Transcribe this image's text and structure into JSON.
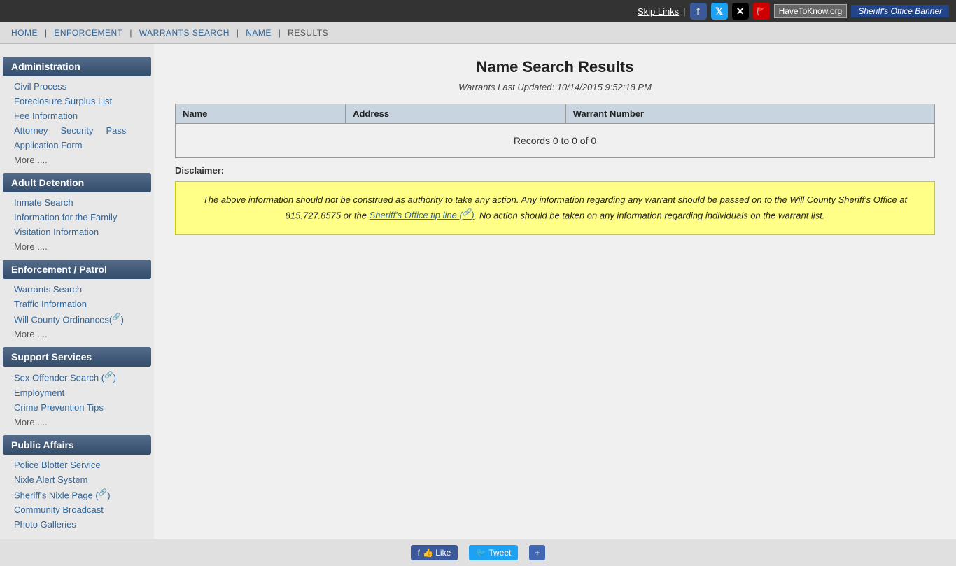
{
  "topbar": {
    "skip_links": "Skip Links",
    "havetoknow": "HaveToKnow.org",
    "sheriff_banner": "Sheriff's Office Banner"
  },
  "breadcrumb": {
    "items": [
      "Home",
      "Enforcement",
      "Warrants Search",
      "Name",
      "Results"
    ],
    "separators": [
      "|",
      "|",
      "|",
      "|"
    ]
  },
  "sidebar": {
    "sections": [
      {
        "id": "administration",
        "header": "Administration",
        "links": [
          {
            "label": "Civil Process",
            "name": "civil-process-link"
          },
          {
            "label": "Foreclosure Surplus List",
            "name": "foreclosure-link"
          },
          {
            "label": "Fee Information",
            "name": "fee-information-link"
          },
          {
            "label": "Attorney     Security     Pass",
            "name": "attorney-security-link"
          },
          {
            "label": "Application Form",
            "name": "application-form-link"
          },
          {
            "label": "More ....",
            "name": "administration-more-link",
            "more": true
          }
        ]
      },
      {
        "id": "adult-detention",
        "header": "Adult Detention",
        "links": [
          {
            "label": "Inmate Search",
            "name": "inmate-search-link"
          },
          {
            "label": "Information for the Family",
            "name": "info-family-link"
          },
          {
            "label": "Visitation Information",
            "name": "visitation-link"
          },
          {
            "label": "More ....",
            "name": "adult-detention-more-link",
            "more": true
          }
        ]
      },
      {
        "id": "enforcement-patrol",
        "header": "Enforcement / Patrol",
        "links": [
          {
            "label": "Warrants Search",
            "name": "warrants-search-link"
          },
          {
            "label": "Traffic Information",
            "name": "traffic-info-link"
          },
          {
            "label": "Will County Ordinances(",
            "name": "ordinances-link",
            "ext": true
          },
          {
            "label": "More ....",
            "name": "enforcement-more-link",
            "more": true
          }
        ]
      },
      {
        "id": "support-services",
        "header": "Support Services",
        "links": [
          {
            "label": "Sex Offender Search (",
            "name": "sex-offender-link",
            "ext": true
          },
          {
            "label": "Employment",
            "name": "employment-link"
          },
          {
            "label": "Crime Prevention Tips",
            "name": "crime-prevention-link"
          },
          {
            "label": "More ....",
            "name": "support-more-link",
            "more": true
          }
        ]
      },
      {
        "id": "public-affairs",
        "header": "Public Affairs",
        "links": [
          {
            "label": "Police Blotter Service",
            "name": "police-blotter-link"
          },
          {
            "label": "Nixle Alert System",
            "name": "nixle-alert-link"
          },
          {
            "label": "Sheriff's Nixle Page (",
            "name": "nixle-page-link",
            "ext": true
          },
          {
            "label": "Community Broadcast",
            "name": "community-broadcast-link"
          },
          {
            "label": "Photo Galleries",
            "name": "photo-galleries-link"
          }
        ]
      }
    ]
  },
  "content": {
    "title": "Name Search Results",
    "last_updated": "Warrants Last Updated: 10/14/2015 9:52:18 PM",
    "table_headers": [
      "Name",
      "Address",
      "Warrant Number"
    ],
    "records_count": "Records 0 to 0 of 0",
    "disclaimer_label": "Disclaimer:",
    "disclaimer_text": "The above information should not be construed as authority to take any action. Any information regarding any warrant should be passed on to the Will County Sheriff's Office at 815.727.8575 or the Sheriff's Office tip line (",
    "disclaimer_link": "🔗",
    "disclaimer_text2": "). No action should be taken on any information regarding individuals on the warrant list."
  },
  "bottombar": {
    "like_label": "👍 Like",
    "tweet_label": "🐦 Tweet",
    "share_label": "+"
  }
}
